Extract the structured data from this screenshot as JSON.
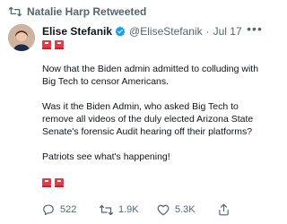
{
  "retweet": {
    "text": "Natalie Harp Retweeted"
  },
  "author": {
    "name": "Elise Stefanik",
    "handle": "@EliseStefanik",
    "separator": "·",
    "date": "Jul 17"
  },
  "tweet": {
    "paragraphs": [
      "Now that the Biden admin admitted to colluding with Big Tech to censor Americans.",
      "Was it the Biden Admin, who asked Big Tech to remove all videos of the duly elected Arizona State Senate's forensic Audit hearing off their platforms?",
      "Patriots see what's happening!"
    ]
  },
  "actions": {
    "reply_count": "522",
    "retweet_count": "1.9K",
    "like_count": "5.3K"
  },
  "colors": {
    "muted": "#536471",
    "text": "#0f1419",
    "verified": "#1d9bf0",
    "flag": "#e63b47"
  },
  "icons": [
    "retweet-icon",
    "verified-badge-icon",
    "more-icon",
    "reply-icon",
    "retweet-action-icon",
    "like-icon",
    "share-icon"
  ]
}
